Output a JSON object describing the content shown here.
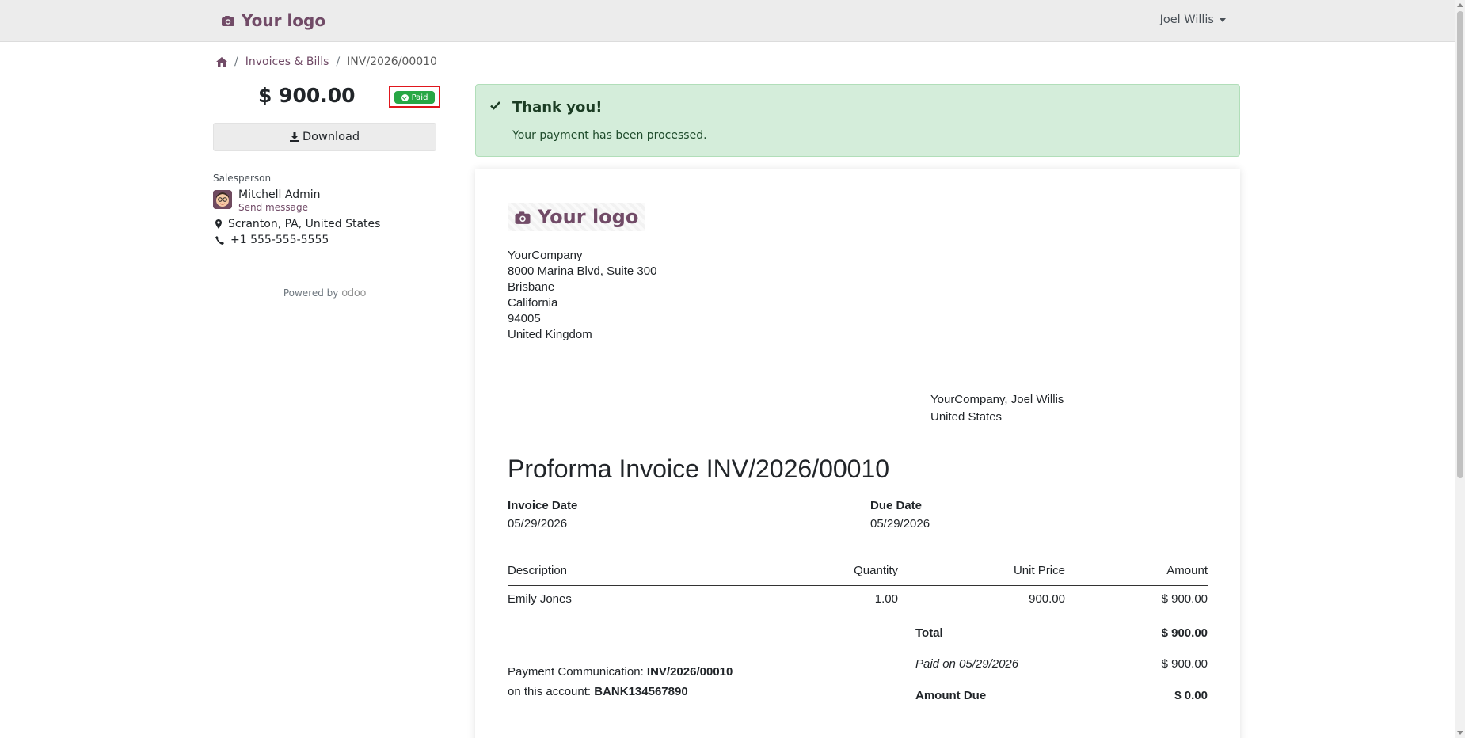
{
  "navbar": {
    "logo_text": "Your logo",
    "user_name": "Joel Willis"
  },
  "breadcrumb": {
    "section": "Invoices & Bills",
    "current": "INV/2026/00010"
  },
  "sidebar": {
    "amount": "$ 900.00",
    "status_badge": "Paid",
    "download_label": "Download",
    "salesperson_label": "Salesperson",
    "salesperson_name": "Mitchell Admin",
    "send_message": "Send message",
    "address": "Scranton, PA, United States",
    "phone": "+1 555-555-5555",
    "powered_by": "Powered by",
    "powered_brand": "odoo"
  },
  "alert": {
    "title": "Thank you!",
    "message": "Your payment has been processed."
  },
  "invoice": {
    "logo_text": "Your logo",
    "company_lines": [
      "YourCompany",
      "8000 Marina Blvd, Suite 300",
      "Brisbane",
      "California",
      "94005",
      "United Kingdom"
    ],
    "recipient_lines": [
      "YourCompany, Joel Willis",
      "United States"
    ],
    "title": "Proforma Invoice INV/2026/00010",
    "invoice_date_label": "Invoice Date",
    "invoice_date": "05/29/2026",
    "due_date_label": "Due Date",
    "due_date": "05/29/2026",
    "columns": [
      "Description",
      "Quantity",
      "Unit Price",
      "Amount"
    ],
    "lines": [
      {
        "description": "Emily Jones",
        "quantity": "1.00",
        "unit_price": "900.00",
        "amount": "$ 900.00"
      }
    ],
    "total_label": "Total",
    "total_value": "$ 900.00",
    "paid_label": "Paid on 05/29/2026",
    "paid_value": "$ 900.00",
    "amount_due_label": "Amount Due",
    "amount_due_value": "$ 0.00",
    "payment_comm_label": "Payment Communication:",
    "payment_comm_value": "INV/2026/00010",
    "account_label": "on this account:",
    "account_value": "BANK134567890"
  },
  "colors": {
    "brand": "#714b67",
    "success": "#28a745",
    "alert_bg": "#d4edda",
    "highlight": "#e0161d"
  }
}
